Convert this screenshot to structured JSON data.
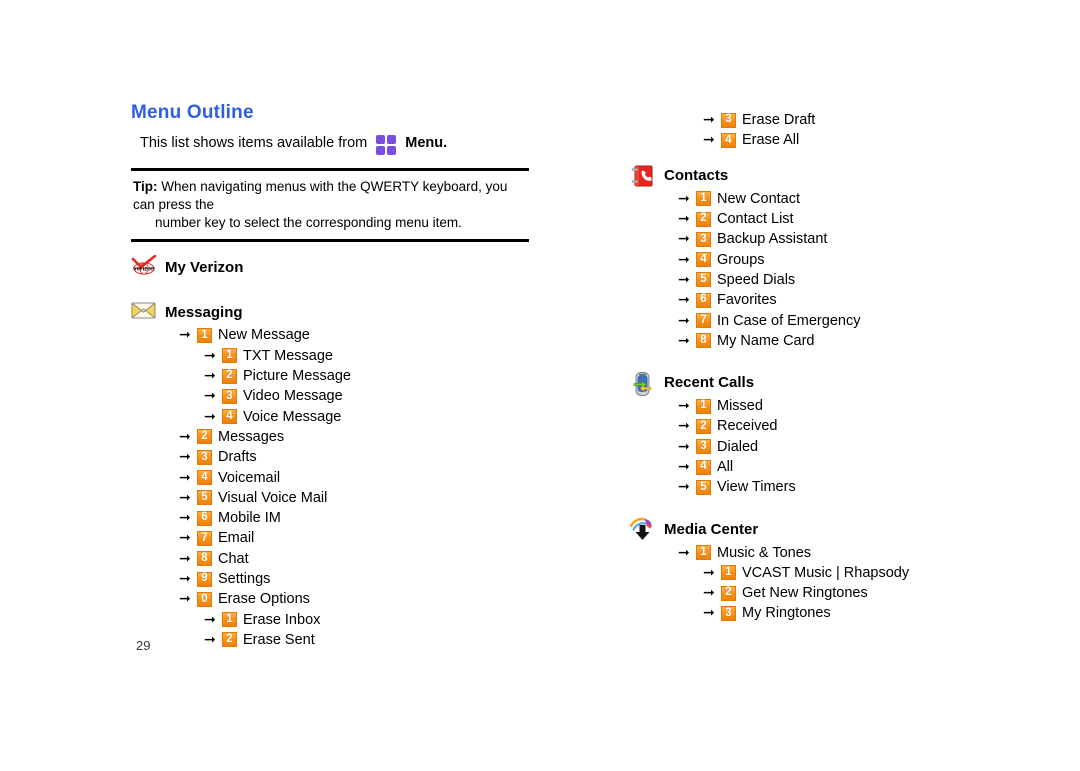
{
  "page": {
    "title": "Menu Outline",
    "intro_text": "This list shows items available from",
    "menu_word": "Menu",
    "menu_word_suffix": ".",
    "menu_icon_name": "menu-grid-icon",
    "page_number": "29"
  },
  "tip": {
    "label": "Tip:",
    "line1": "When navigating menus with the QWERTY keyboard, you can press the",
    "line2": "number key to select the corresponding menu item."
  },
  "colors": {
    "heading_blue": "#2f5fe0",
    "badge_orange": "#f7941e",
    "badge_orange_dark": "#ef7f09",
    "menu_purple": "#7a4fe0",
    "contacts_red": "#e8281e",
    "rule_black": "#000000"
  },
  "sections": [
    {
      "id": "my-verizon",
      "label": "My Verizon",
      "icon": "verizon-logo-icon",
      "items": []
    },
    {
      "id": "messaging",
      "label": "Messaging",
      "icon": "envelope-icon",
      "items": [
        {
          "num": "1",
          "label": "New Message",
          "level": 1
        },
        {
          "num": "1",
          "label": "TXT Message",
          "level": 2
        },
        {
          "num": "2",
          "label": "Picture Message",
          "level": 2
        },
        {
          "num": "3",
          "label": "Video Message",
          "level": 2
        },
        {
          "num": "4",
          "label": "Voice Message",
          "level": 2
        },
        {
          "num": "2",
          "label": "Messages",
          "level": 1
        },
        {
          "num": "3",
          "label": "Drafts",
          "level": 1
        },
        {
          "num": "4",
          "label": "Voicemail",
          "level": 1
        },
        {
          "num": "5",
          "label": "Visual Voice Mail",
          "level": 1
        },
        {
          "num": "6",
          "label": "Mobile IM",
          "level": 1
        },
        {
          "num": "7",
          "label": "Email",
          "level": 1
        },
        {
          "num": "8",
          "label": "Chat",
          "level": 1
        },
        {
          "num": "9",
          "label": "Settings",
          "level": 1
        },
        {
          "num": "0",
          "label": "Erase Options",
          "level": 1
        },
        {
          "num": "1",
          "label": "Erase Inbox",
          "level": 2
        },
        {
          "num": "2",
          "label": "Erase Sent",
          "level": 2
        }
      ]
    },
    {
      "id": "messaging-continued",
      "label": "",
      "icon": "",
      "items": [
        {
          "num": "3",
          "label": "Erase Draft",
          "level": 2
        },
        {
          "num": "4",
          "label": "Erase All",
          "level": 2
        }
      ]
    },
    {
      "id": "contacts",
      "label": "Contacts",
      "icon": "contacts-book-icon",
      "items": [
        {
          "num": "1",
          "label": "New Contact",
          "level": 1
        },
        {
          "num": "2",
          "label": "Contact List",
          "level": 1
        },
        {
          "num": "3",
          "label": "Backup Assistant",
          "level": 1
        },
        {
          "num": "4",
          "label": "Groups",
          "level": 1
        },
        {
          "num": "5",
          "label": "Speed Dials",
          "level": 1
        },
        {
          "num": "6",
          "label": "Favorites",
          "level": 1
        },
        {
          "num": "7",
          "label": "In Case of Emergency",
          "level": 1
        },
        {
          "num": "8",
          "label": "My Name Card",
          "level": 1
        }
      ]
    },
    {
      "id": "recent-calls",
      "label": "Recent Calls",
      "icon": "recent-calls-phone-icon",
      "items": [
        {
          "num": "1",
          "label": "Missed",
          "level": 1
        },
        {
          "num": "2",
          "label": "Received",
          "level": 1
        },
        {
          "num": "3",
          "label": "Dialed",
          "level": 1
        },
        {
          "num": "4",
          "label": "All",
          "level": 1
        },
        {
          "num": "5",
          "label": "View Timers",
          "level": 1
        }
      ]
    },
    {
      "id": "media-center",
      "label": "Media Center",
      "icon": "media-center-download-icon",
      "items": [
        {
          "num": "1",
          "label": "Music & Tones",
          "level": 1
        },
        {
          "num": "1",
          "label": "VCAST Music | Rhapsody",
          "level": 2
        },
        {
          "num": "2",
          "label": "Get New Ringtones",
          "level": 2
        },
        {
          "num": "3",
          "label": "My Ringtones",
          "level": 2
        }
      ]
    }
  ]
}
